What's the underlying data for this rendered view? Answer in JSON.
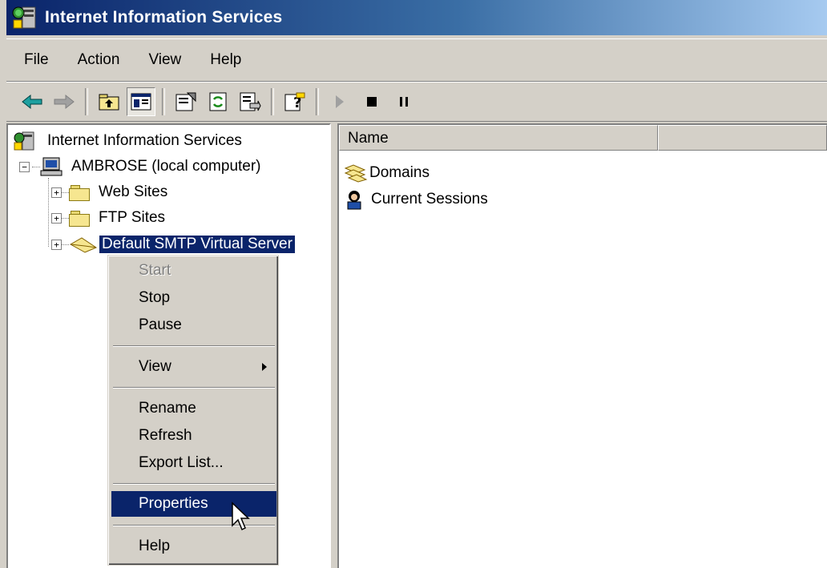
{
  "window": {
    "title": "Internet Information Services"
  },
  "menubar": {
    "items": [
      "File",
      "Action",
      "View",
      "Help"
    ]
  },
  "toolbar": {
    "buttons": [
      {
        "icon": "back-arrow-icon"
      },
      {
        "icon": "forward-arrow-icon"
      },
      {
        "icon": "up-one-level-icon"
      },
      {
        "icon": "show-hide-console-tree-icon"
      },
      {
        "icon": "properties-icon"
      },
      {
        "icon": "refresh-icon"
      },
      {
        "icon": "export-list-icon"
      },
      {
        "icon": "help-icon"
      },
      {
        "icon": "start-play-icon"
      },
      {
        "icon": "stop-icon"
      },
      {
        "icon": "pause-icon"
      }
    ]
  },
  "tree": {
    "root": "Internet Information Services",
    "computer": "AMBROSE (local computer)",
    "children": [
      "Web Sites",
      "FTP Sites",
      "Default SMTP Virtual Server"
    ],
    "selected": "Default SMTP Virtual Server"
  },
  "list": {
    "columns": [
      "Name",
      ""
    ],
    "items": [
      {
        "label": "Domains",
        "icon": "domains-icon"
      },
      {
        "label": "Current Sessions",
        "icon": "current-sessions-icon"
      }
    ]
  },
  "context_menu": {
    "items": [
      {
        "label": "Start",
        "disabled": true
      },
      {
        "label": "Stop"
      },
      {
        "label": "Pause"
      },
      {
        "label": "View",
        "submenu": true
      },
      {
        "label": "Rename"
      },
      {
        "label": "Refresh"
      },
      {
        "label": "Export List..."
      },
      {
        "label": "Properties",
        "highlighted": true
      },
      {
        "label": "Help"
      }
    ]
  },
  "colors": {
    "title_start": "#0a246a",
    "title_end": "#a6caf0",
    "selection": "#0a246a",
    "face": "#d4d0c8"
  }
}
